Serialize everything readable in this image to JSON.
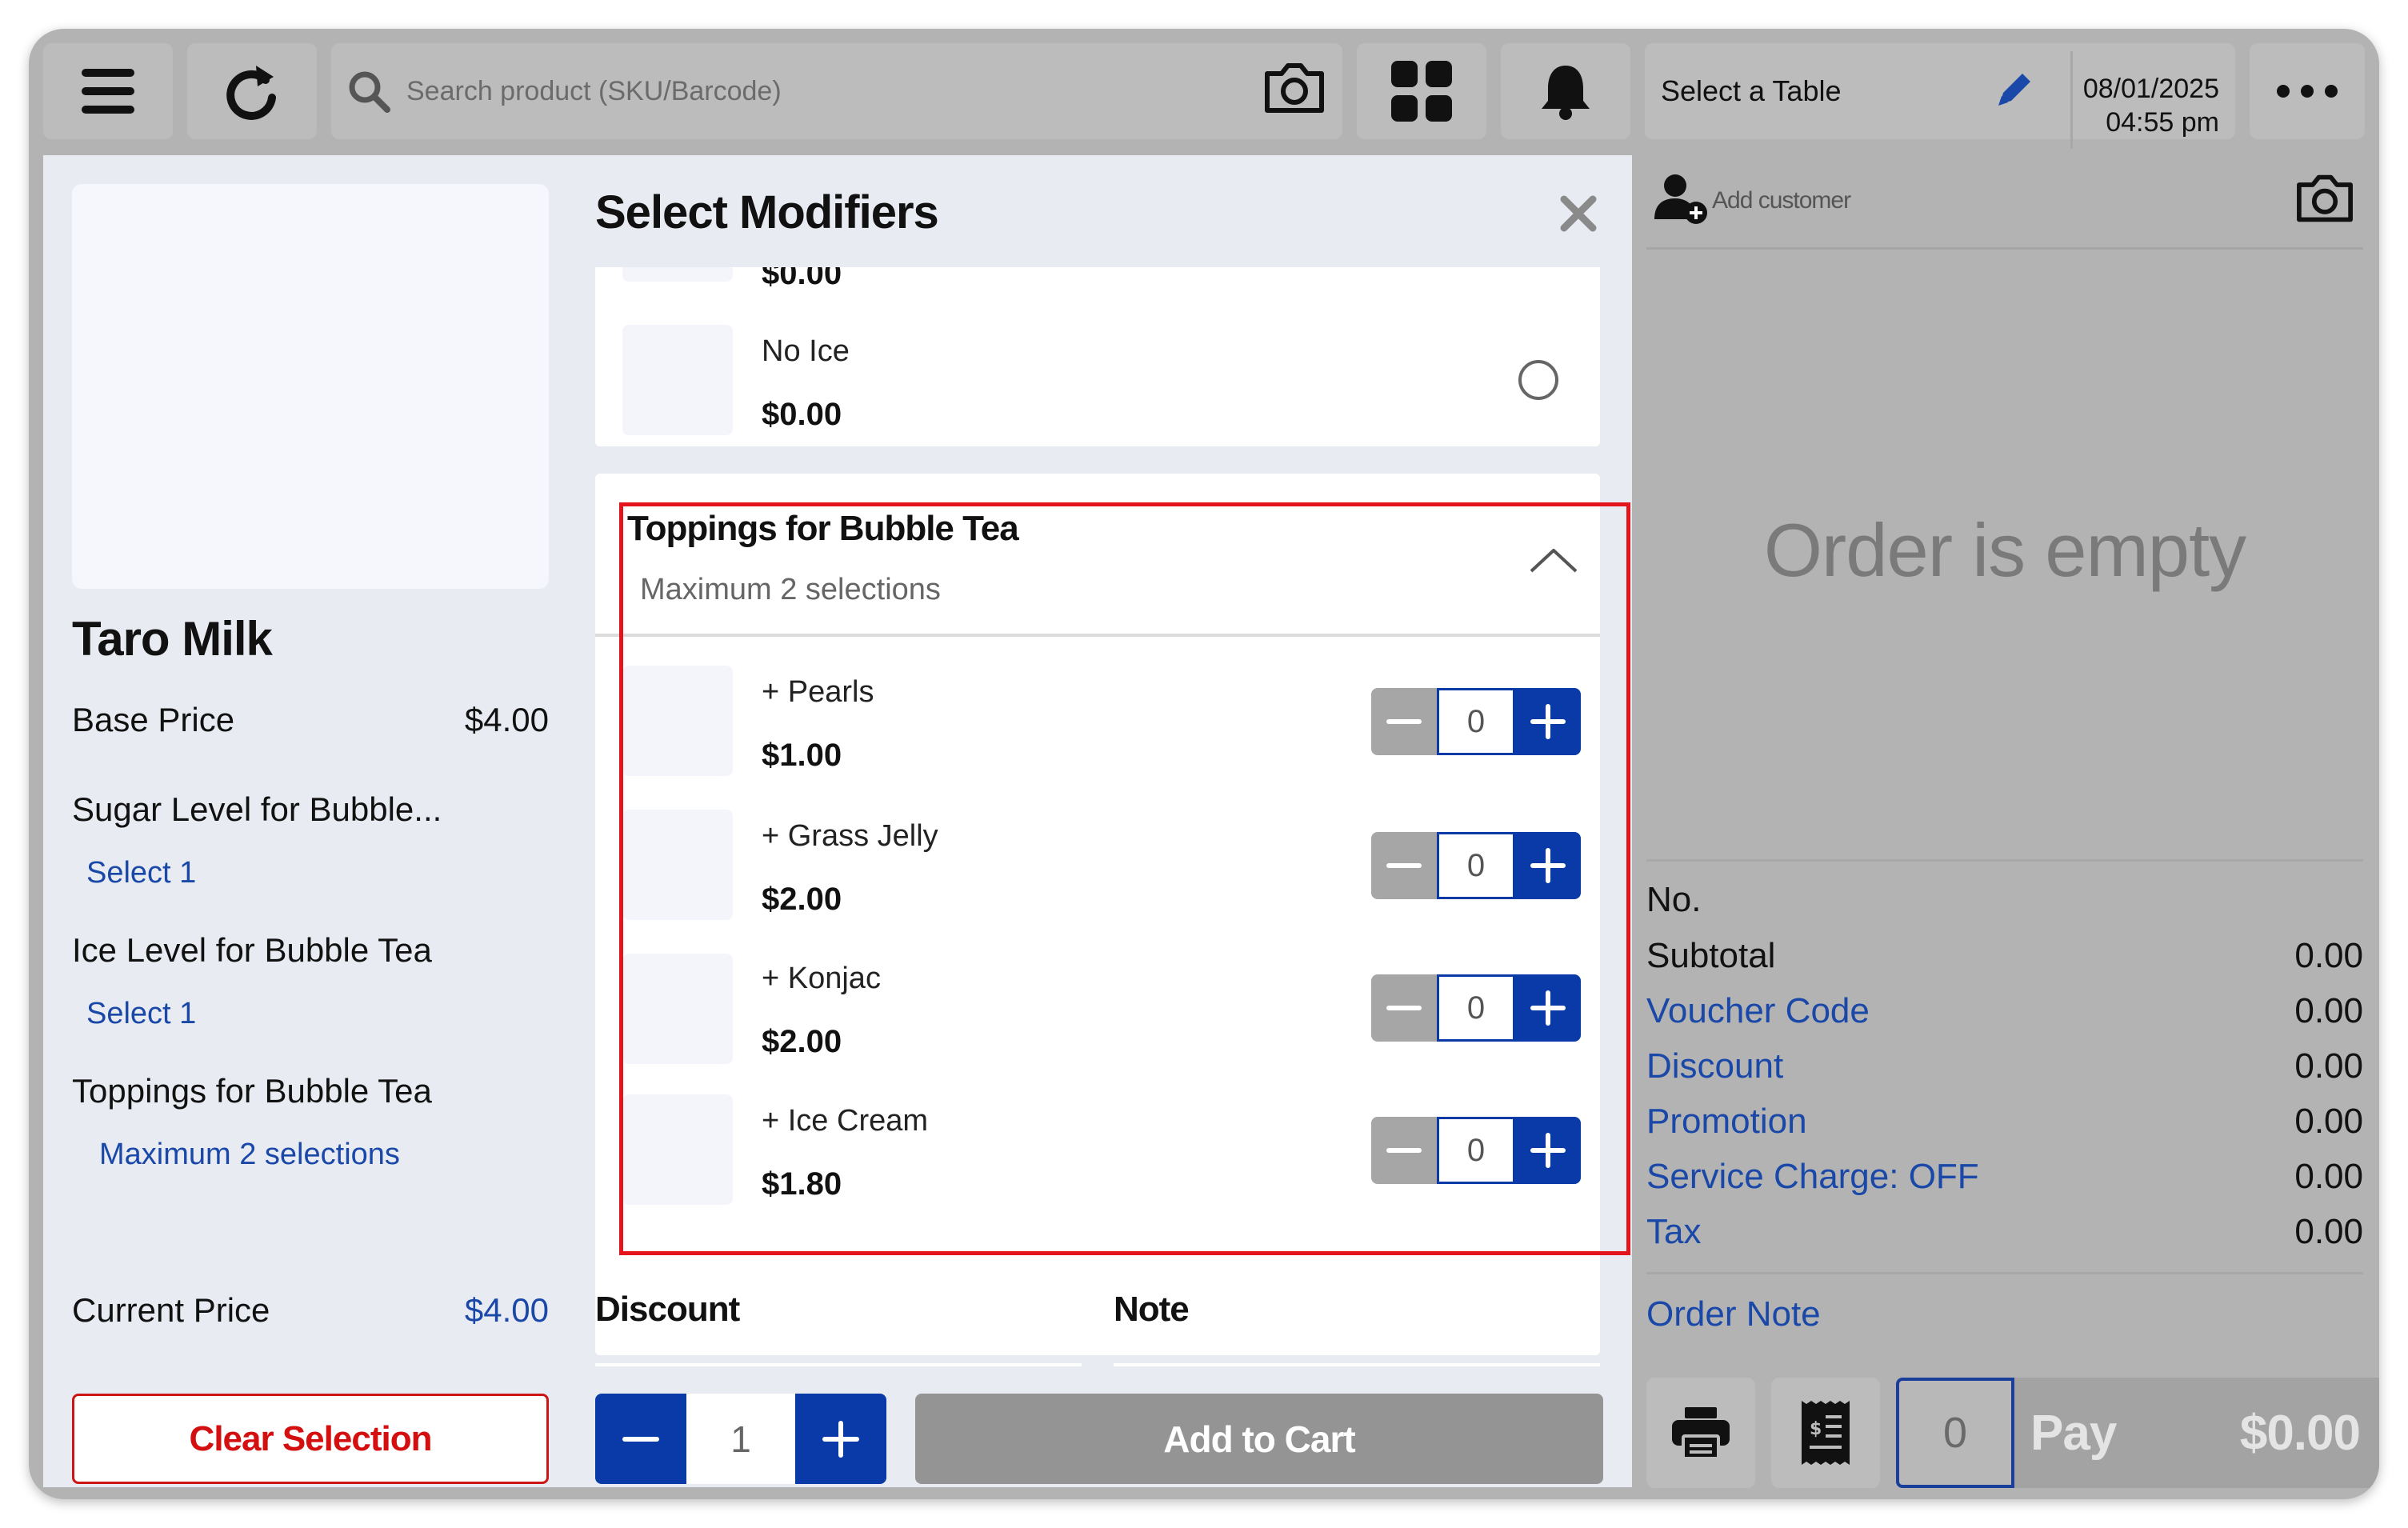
{
  "topbar": {
    "search_placeholder": "Search product (SKU/Barcode)",
    "table_label": "Select a Table",
    "date": "08/01/2025",
    "time": "04:55 pm"
  },
  "product": {
    "name": "Taro Milk",
    "base_price_label": "Base Price",
    "base_price": "$4.00",
    "summary": [
      {
        "label": "Sugar Level for Bubble...",
        "status": "Select 1"
      },
      {
        "label": "Ice Level for Bubble Tea",
        "status": "Select 1"
      },
      {
        "label": "Toppings for Bubble Tea",
        "status": "Maximum 2 selections"
      }
    ],
    "current_price_label": "Current Price",
    "current_price": "$4.00",
    "clear_label": "Clear Selection"
  },
  "modal": {
    "title": "Select Modifiers",
    "partial_option_price": "$0.00",
    "ice_option": {
      "name": "No Ice",
      "price": "$0.00"
    },
    "toppings_group": {
      "title": "Toppings for Bubble Tea",
      "subtitle": "Maximum 2 selections",
      "options": [
        {
          "name": "+ Pearls",
          "price": "$1.00",
          "qty": "0"
        },
        {
          "name": "+ Grass Jelly",
          "price": "$2.00",
          "qty": "0"
        },
        {
          "name": "+ Konjac",
          "price": "$2.00",
          "qty": "0"
        },
        {
          "name": "+ Ice Cream",
          "price": "$1.80",
          "qty": "0"
        }
      ]
    },
    "discount_label": "Discount",
    "note_label": "Note",
    "quantity": "1",
    "add_to_cart_label": "Add to Cart"
  },
  "order": {
    "add_customer_label": "Add customer",
    "empty_text": "Order is empty",
    "no_label": "No.",
    "totals": [
      {
        "label": "Subtotal",
        "value": "0.00",
        "link": false
      },
      {
        "label": "Voucher Code",
        "value": "0.00",
        "link": true
      },
      {
        "label": "Discount",
        "value": "0.00",
        "link": true
      },
      {
        "label": "Promotion",
        "value": "0.00",
        "link": true
      },
      {
        "label": "Service Charge: OFF",
        "value": "0.00",
        "link": true
      },
      {
        "label": "Tax",
        "value": "0.00",
        "link": true
      }
    ],
    "order_note_label": "Order Note",
    "pay_count": "0",
    "pay_label": "Pay",
    "pay_amount": "$0.00"
  },
  "colors": {
    "accent_blue": "#0a3aa8",
    "link_blue": "#1a48a8",
    "danger_red": "#d40f0f",
    "highlight_frame": "#e3141c"
  },
  "icons": [
    "menu-icon",
    "refresh-icon",
    "search-icon",
    "camera-icon",
    "grid-icon",
    "bell-icon",
    "pencil-icon",
    "more-icon",
    "close-icon",
    "chevron-up-icon",
    "add-person-icon",
    "printer-icon",
    "receipt-icon",
    "minus-icon",
    "plus-icon"
  ]
}
